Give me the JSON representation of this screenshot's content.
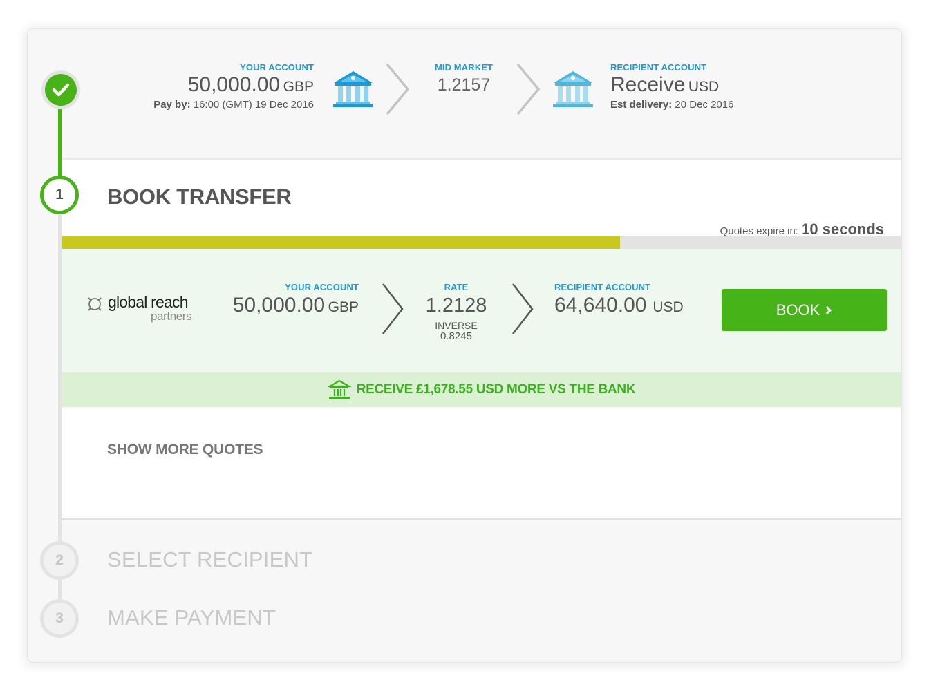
{
  "summary": {
    "your_account": {
      "label": "YOUR ACCOUNT",
      "amount": "50,000.00",
      "currency": "GBP",
      "pay_by_label": "Pay by:",
      "pay_by_value": "16:00 (GMT) 19 Dec 2016"
    },
    "mid_market": {
      "label": "MID MARKET",
      "value": "1.2157"
    },
    "recipient_account": {
      "label": "RECIPIENT ACCOUNT",
      "amount": "Receive",
      "currency": "USD",
      "delivery_label": "Est delivery:",
      "delivery_value": "20 Dec 2016"
    },
    "icons": [
      "bank-icon",
      "chevron-right-icon",
      "bank-icon"
    ]
  },
  "steps": [
    {
      "number": "1",
      "title": "BOOK TRANSFER",
      "state": "active"
    },
    {
      "number": "2",
      "title": "SELECT RECIPIENT",
      "state": "pending"
    },
    {
      "number": "3",
      "title": "MAKE PAYMENT",
      "state": "pending"
    }
  ],
  "quote_timer": {
    "label": "Quotes expire in:",
    "value": "10 seconds",
    "progress_fraction": 0.665
  },
  "quote": {
    "provider_name": "global reach",
    "provider_sub": "partners",
    "your_account_label": "YOUR ACCOUNT",
    "your_amount": "50,000.00",
    "your_currency": "GBP",
    "rate_label": "RATE",
    "rate_value": "1.2128",
    "inverse_label": "INVERSE",
    "inverse_value": "0.8245",
    "recipient_label": "RECIPIENT ACCOUNT",
    "recipient_amount": "64,640.00",
    "recipient_currency": "USD",
    "book_label": "BOOK",
    "savings_text": "RECEIVE £1,678.55 USD MORE VS THE BANK"
  },
  "show_more_label": "SHOW MORE QUOTES",
  "colors": {
    "accent_blue": "#1a9ad6",
    "success_green": "#46b418",
    "timer_bar": "#c8c81d",
    "quote_bg": "#eff8ef",
    "savings_bg": "#dcf0d4"
  }
}
